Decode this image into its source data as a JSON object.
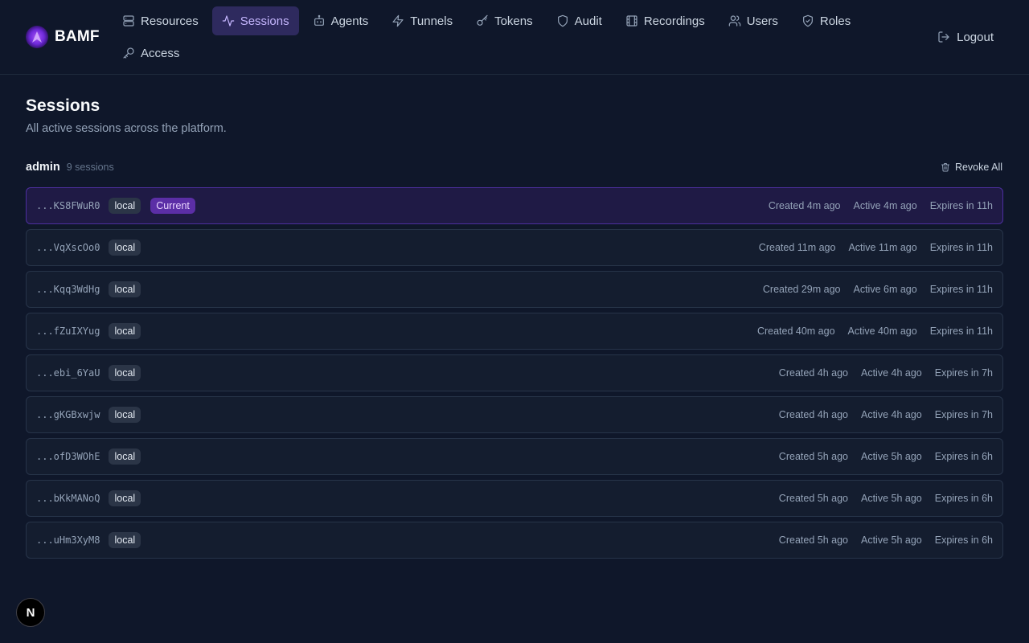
{
  "brand": {
    "name": "BAMF"
  },
  "nav": {
    "rows": [
      [
        {
          "id": "resources",
          "label": "Resources",
          "icon": "server-icon",
          "active": false
        },
        {
          "id": "sessions",
          "label": "Sessions",
          "icon": "activity-icon",
          "active": true
        },
        {
          "id": "agents",
          "label": "Agents",
          "icon": "bot-icon",
          "active": false
        },
        {
          "id": "tunnels",
          "label": "Tunnels",
          "icon": "zap-icon",
          "active": false
        },
        {
          "id": "tokens",
          "label": "Tokens",
          "icon": "key-icon",
          "active": false
        },
        {
          "id": "audit",
          "label": "Audit",
          "icon": "shield-icon",
          "active": false
        },
        {
          "id": "recordings",
          "label": "Recordings",
          "icon": "film-icon",
          "active": false
        },
        {
          "id": "users",
          "label": "Users",
          "icon": "users-icon",
          "active": false
        },
        {
          "id": "roles",
          "label": "Roles",
          "icon": "shield-check-icon",
          "active": false
        }
      ],
      [
        {
          "id": "access",
          "label": "Access",
          "icon": "key-round-icon",
          "active": false
        }
      ]
    ],
    "logout_label": "Logout"
  },
  "page": {
    "title": "Sessions",
    "subtitle": "All active sessions across the platform."
  },
  "group": {
    "user": "admin",
    "count_label": "9 sessions",
    "revoke_all_label": "Revoke All"
  },
  "sessions": [
    {
      "id": "...KS8FWuR0",
      "provider": "local",
      "current": true,
      "current_label": "Current",
      "created": "Created 4m ago",
      "active": "Active 4m ago",
      "expires": "Expires in 11h"
    },
    {
      "id": "...VqXscOo0",
      "provider": "local",
      "current": false,
      "created": "Created 11m ago",
      "active": "Active 11m ago",
      "expires": "Expires in 11h"
    },
    {
      "id": "...Kqq3WdHg",
      "provider": "local",
      "current": false,
      "created": "Created 29m ago",
      "active": "Active 6m ago",
      "expires": "Expires in 11h"
    },
    {
      "id": "...fZuIXYug",
      "provider": "local",
      "current": false,
      "created": "Created 40m ago",
      "active": "Active 40m ago",
      "expires": "Expires in 11h"
    },
    {
      "id": "...ebi_6YaU",
      "provider": "local",
      "current": false,
      "created": "Created 4h ago",
      "active": "Active 4h ago",
      "expires": "Expires in 7h"
    },
    {
      "id": "...gKGBxwjw",
      "provider": "local",
      "current": false,
      "created": "Created 4h ago",
      "active": "Active 4h ago",
      "expires": "Expires in 7h"
    },
    {
      "id": "...ofD3WOhE",
      "provider": "local",
      "current": false,
      "created": "Created 5h ago",
      "active": "Active 5h ago",
      "expires": "Expires in 6h"
    },
    {
      "id": "...bKkMANoQ",
      "provider": "local",
      "current": false,
      "created": "Created 5h ago",
      "active": "Active 5h ago",
      "expires": "Expires in 6h"
    },
    {
      "id": "...uHm3XyM8",
      "provider": "local",
      "current": false,
      "created": "Created 5h ago",
      "active": "Active 5h ago",
      "expires": "Expires in 6h"
    }
  ],
  "dev_indicator": {
    "label": "N"
  }
}
